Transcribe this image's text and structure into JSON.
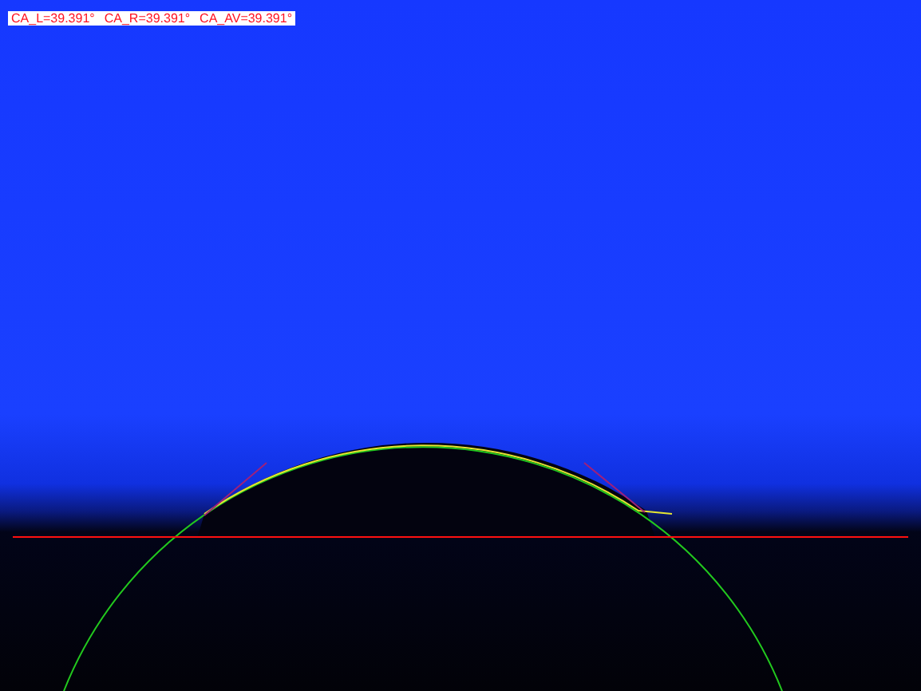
{
  "measurements": [
    {
      "label": "CA_L=39.391°"
    },
    {
      "label": "CA_R=39.391°"
    },
    {
      "label": "CA_AV=39.391°"
    }
  ]
}
